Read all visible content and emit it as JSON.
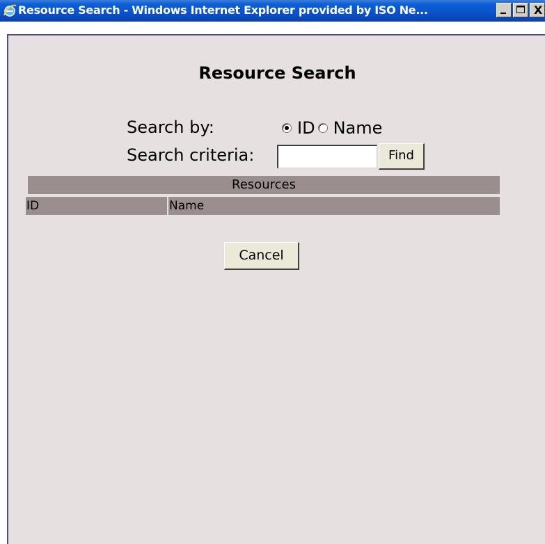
{
  "window": {
    "title": "Resource Search - Windows Internet Explorer provided by ISO Ne...",
    "titlebar_color": "#0a4fc6",
    "controls": {
      "minimize_icon": "minimize-icon",
      "maximize_icon": "maximize-icon",
      "close_label": "X"
    }
  },
  "page": {
    "title": "Resource Search",
    "background_color": "#e6e0e0",
    "search_by": {
      "label": "Search by:",
      "options": [
        {
          "label": "ID",
          "checked": true
        },
        {
          "label": "Name",
          "checked": false
        }
      ]
    },
    "criteria": {
      "label": "Search criteria:",
      "value": "",
      "placeholder": ""
    },
    "find_button": "Find",
    "table": {
      "caption": "Resources",
      "header_color": "#9a8e8e",
      "columns": [
        "ID",
        "Name"
      ],
      "rows": []
    },
    "cancel_button": "Cancel"
  }
}
